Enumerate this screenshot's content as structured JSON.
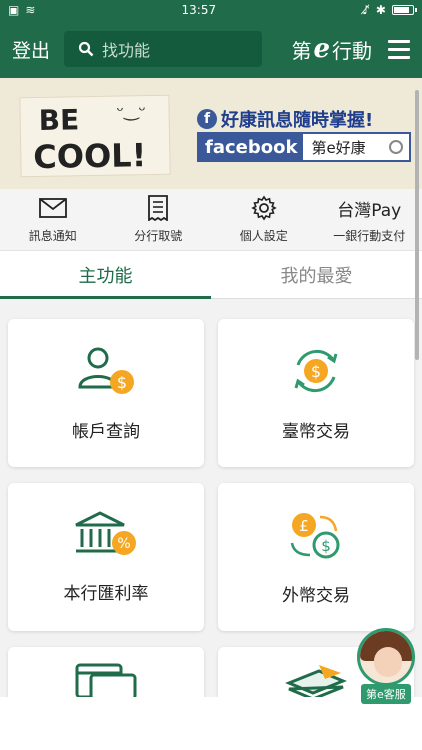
{
  "status_bar": {
    "time": "13:57"
  },
  "header": {
    "logout_label": "登出",
    "search_placeholder": "找功能",
    "brand_prefix": "第",
    "brand_e": "e",
    "brand_suffix": "行動"
  },
  "banner": {
    "note_line1": "BE",
    "note_line2": "COOL!",
    "slogan": "好康訊息隨時掌握!",
    "facebook_label": "facebook",
    "facebook_page": "第e好康"
  },
  "quick_links": [
    {
      "label": "訊息通知",
      "icon": "mail-icon"
    },
    {
      "label": "分行取號",
      "icon": "ticket-icon"
    },
    {
      "label": "個人設定",
      "icon": "gear-icon"
    },
    {
      "label": "一銀行動支付",
      "title": "台灣Pay",
      "icon": "taiwanpay-logo"
    }
  ],
  "tabs": [
    {
      "label": "主功能",
      "active": true
    },
    {
      "label": "我的最愛",
      "active": false
    }
  ],
  "cards": [
    {
      "label": "帳戶查詢",
      "icon": "account-user-dollar-icon"
    },
    {
      "label": "臺幣交易",
      "icon": "twd-exchange-icon"
    },
    {
      "label": "本行匯利率",
      "icon": "bank-percent-icon"
    },
    {
      "label": "外幣交易",
      "icon": "foreign-currency-exchange-icon"
    },
    {
      "label": "",
      "icon": "cards-icon"
    },
    {
      "label": "",
      "icon": "cash-stack-icon"
    }
  ],
  "service_badge": "第e客服",
  "colors": {
    "primary": "#1f6b4a",
    "accent_orange": "#f5a623",
    "service_green": "#2e9a6d"
  }
}
